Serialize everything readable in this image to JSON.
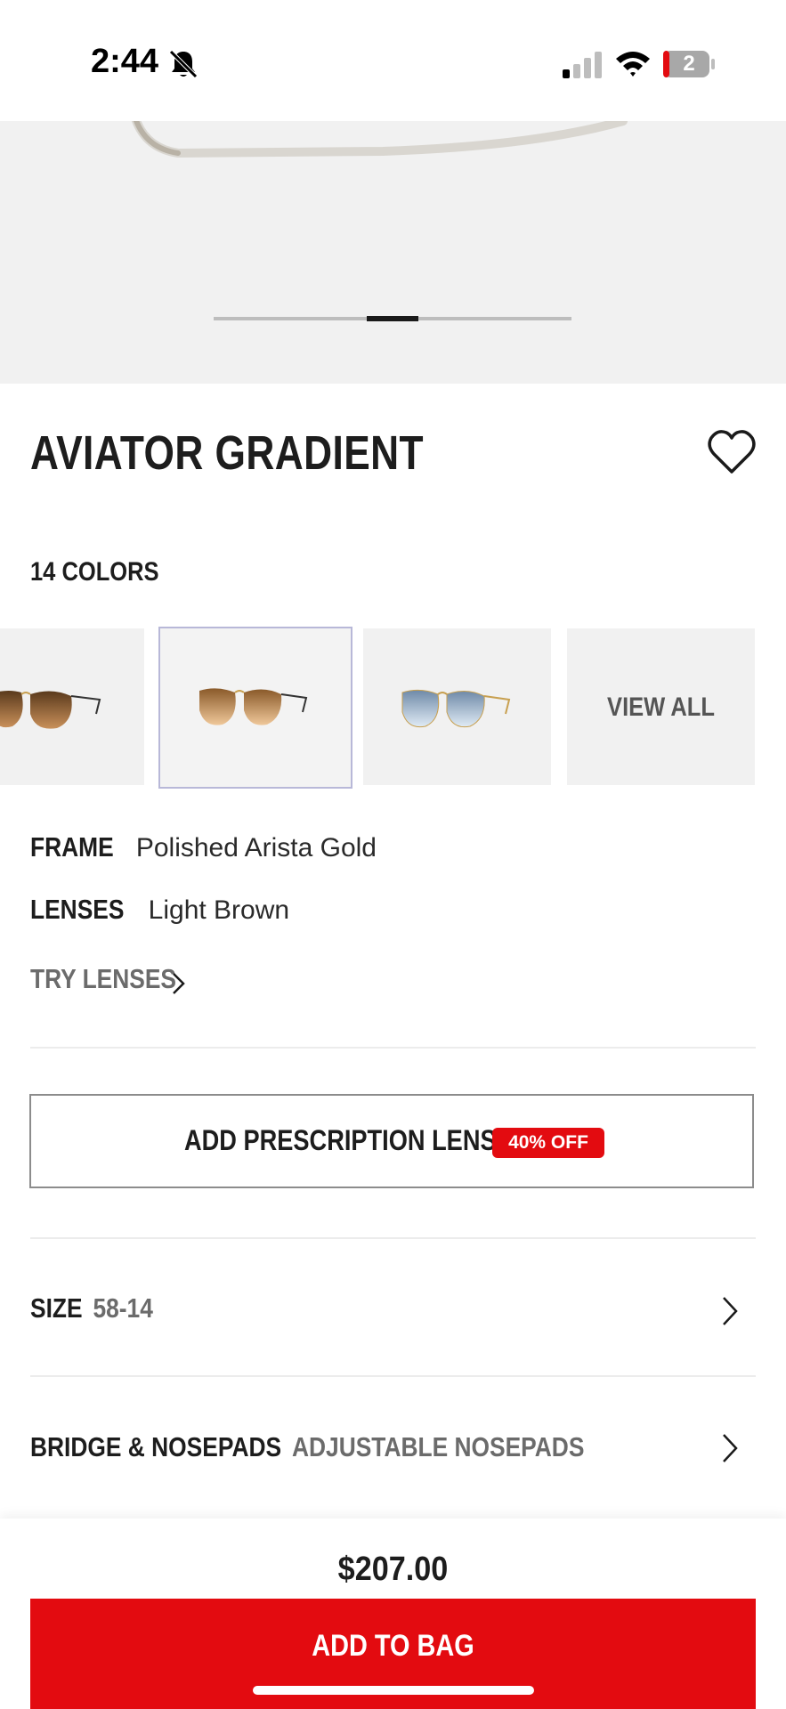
{
  "status_bar": {
    "time": "2:44",
    "battery": "2"
  },
  "product": {
    "title": "AVIATOR GRADIENT",
    "colors_label": "14 COLORS",
    "swatches": [
      {
        "name": "brown-gradient-gold",
        "selected": false
      },
      {
        "name": "light-brown-gold",
        "selected": true
      },
      {
        "name": "light-blue-gold",
        "selected": false
      }
    ],
    "view_all": "VIEW ALL",
    "frame_label": "FRAME",
    "frame_value": "Polished Arista Gold",
    "lenses_label": "LENSES",
    "lenses_value": "Light Brown",
    "try_lenses": "TRY LENSES"
  },
  "prescription": {
    "label": "ADD PRESCRIPTION LENSES",
    "badge": "40% OFF"
  },
  "size": {
    "label": "SIZE",
    "value": "58-14"
  },
  "bridge": {
    "label": "BRIDGE & NOSEPADS",
    "value": "ADJUSTABLE NOSEPADS"
  },
  "purchase": {
    "price": "$207.00",
    "button": "ADD TO BAG"
  },
  "colors": {
    "accent": "#e30b10",
    "background": "#f1f1f1"
  },
  "carousel": {
    "active_index": 2,
    "total": 5
  }
}
